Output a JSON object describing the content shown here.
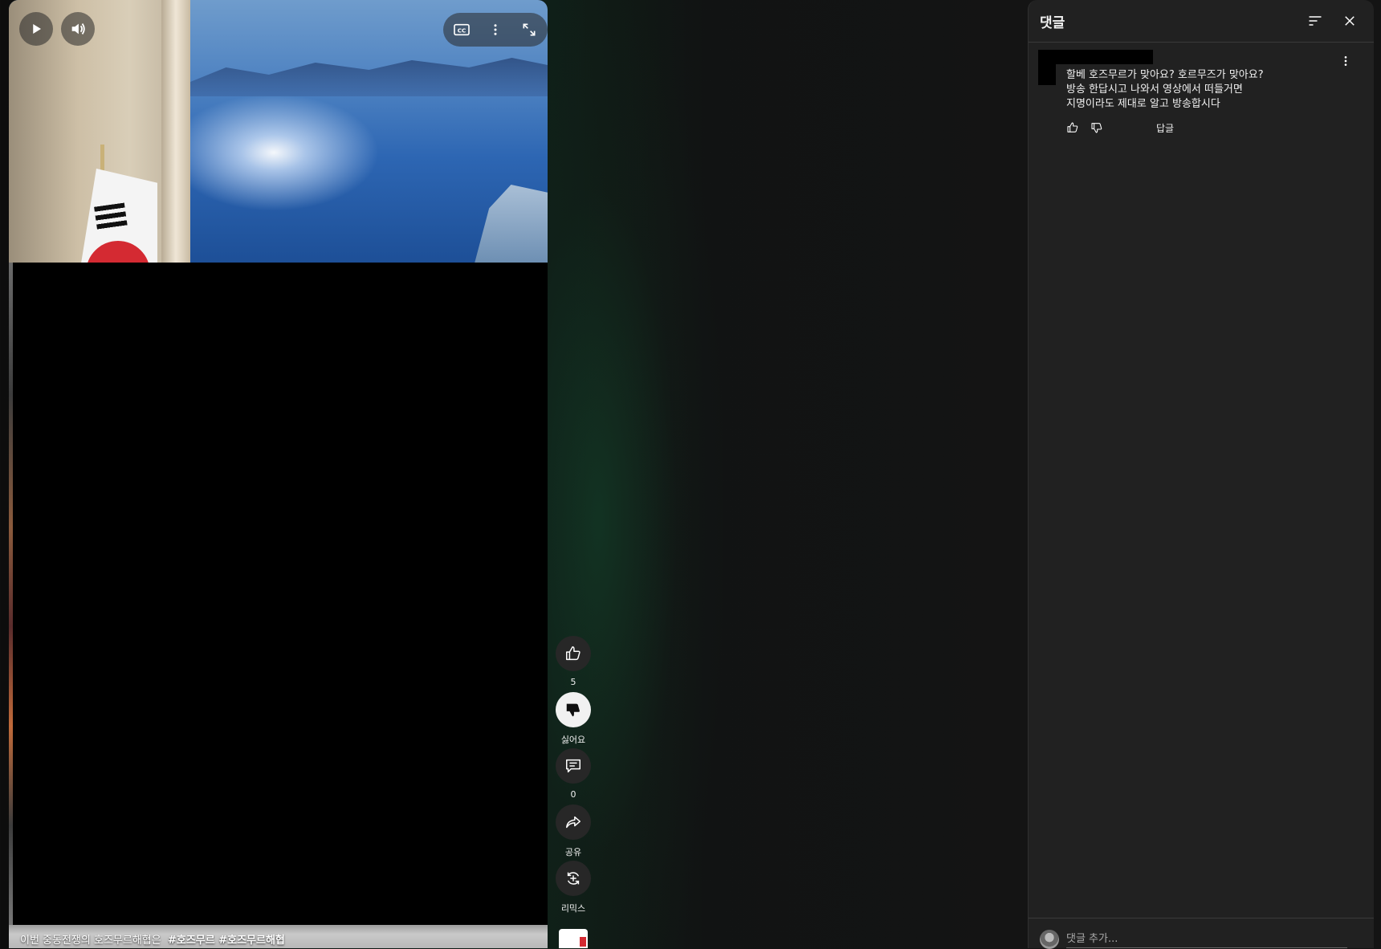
{
  "video": {
    "caption_text": "이번 중동전쟁의 호즈무르해협은",
    "caption_tags": "#호즈무르 #호즈무르해협",
    "controls": {
      "play_icon": "play-icon",
      "volume_icon": "volume-icon",
      "cc_icon": "cc-icon",
      "more_icon": "more-vert-icon",
      "fullscreen_icon": "fullscreen-icon"
    }
  },
  "actions": {
    "like_count": "5",
    "dislike_label": "싫어요",
    "comments_count": "0",
    "share_label": "공유",
    "remix_label": "리믹스"
  },
  "comments_panel": {
    "title": "댓글",
    "comment": {
      "lines": [
        "할베 호즈무르가 맞아요? 호르무즈가 맞아요?",
        "방송 한답시고 나와서 영상에서 떠들거면",
        "지명이라도 제대로 알고 방송합시다"
      ],
      "reply_label": "답글"
    },
    "input_placeholder": "댓글 추가..."
  },
  "colors": {
    "panel_bg": "#212121",
    "button_bg": "#272727",
    "text": "#f1f1f1",
    "secondary_text": "#aaaaaa"
  }
}
